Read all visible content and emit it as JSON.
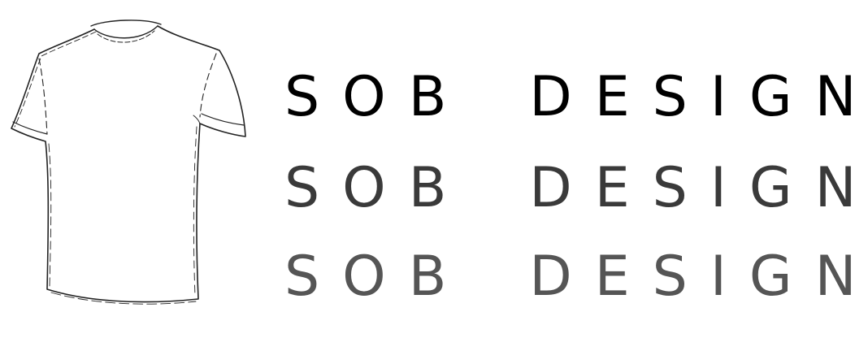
{
  "logo": {
    "rows": [
      {
        "left_word": "SOB",
        "right_word": "DESIGN",
        "color": "#000000"
      },
      {
        "left_word": "SOB",
        "right_word": "DESIGN",
        "color": "#3a3a3a"
      },
      {
        "left_word": "SOB",
        "right_word": "DESIGN",
        "color": "#555555"
      }
    ]
  },
  "illustration": {
    "icon": "t-shirt-sketch-icon",
    "stroke_color": "#222222"
  }
}
